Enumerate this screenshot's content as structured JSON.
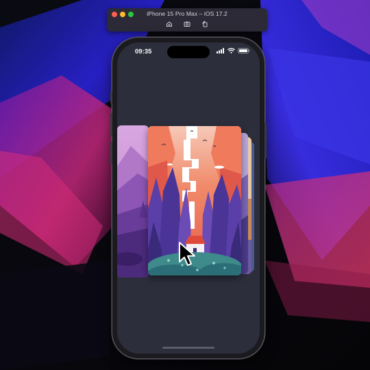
{
  "simulator": {
    "title": "iPhone 15 Pro Max – iOS 17.2",
    "toolbar_icons": [
      "home-icon",
      "screenshot-icon",
      "rotate-icon"
    ]
  },
  "status_bar": {
    "time": "09:35",
    "icons": [
      "signal-icon",
      "wifi-icon",
      "battery-icon"
    ]
  },
  "cards": [
    {
      "name": "purple-mountain-landscape"
    },
    {
      "name": "red-forest-waterfall-landscape"
    },
    {
      "name": "stacked-card-1"
    },
    {
      "name": "stacked-card-2"
    },
    {
      "name": "stacked-card-3"
    }
  ],
  "colors": {
    "screen_background": "#2c2e3c",
    "desktop_blue": "#2a1fd8",
    "desktop_pink": "#d92a6f"
  }
}
